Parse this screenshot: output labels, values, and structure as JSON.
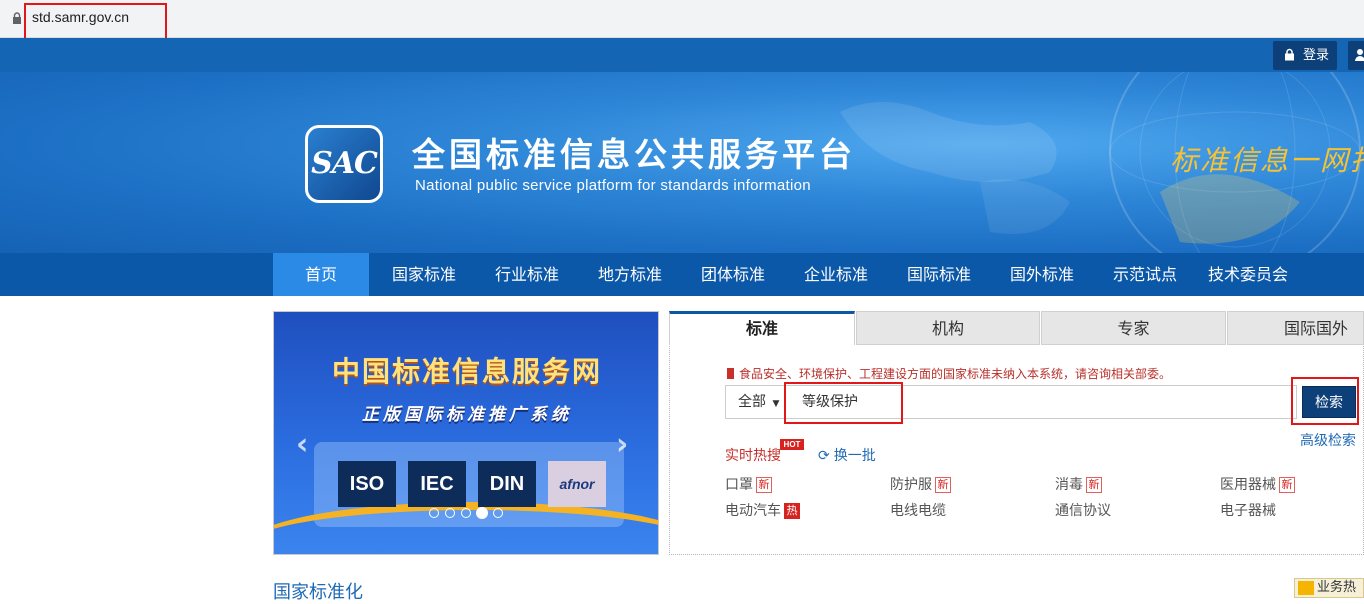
{
  "browser": {
    "url": "std.samr.gov.cn",
    "lock_icon": "lock-icon"
  },
  "header": {
    "login_label": "登录"
  },
  "banner": {
    "title_cn": "全国标准信息公共服务平台",
    "title_en": "National public service platform  for standards information",
    "logo_text": "SAC",
    "slogan": "标准信息一网打尽"
  },
  "nav": {
    "items": [
      {
        "label": "首页"
      },
      {
        "label": "国家标准"
      },
      {
        "label": "行业标准"
      },
      {
        "label": "地方标准"
      },
      {
        "label": "团体标准"
      },
      {
        "label": "企业标准"
      },
      {
        "label": "国际标准"
      },
      {
        "label": "国外标准"
      },
      {
        "label": "示范试点"
      },
      {
        "label": "技术委员会"
      }
    ],
    "active_index": 0
  },
  "carousel": {
    "title": "中国标准信息服务网",
    "subtitle": "正版国际标准推广系统",
    "logos": [
      "ISO",
      "IEC",
      "DIN",
      "afnor"
    ],
    "slide_count": 5,
    "active_slide": 4
  },
  "search": {
    "tabs": [
      "标准",
      "机构",
      "专家",
      "国际国外"
    ],
    "active_tab": 0,
    "notice": "食品安全、环境保护、工程建设方面的国家标准未纳入本系统，请咨询相关部委。",
    "scope": "全部",
    "query": "等级保护",
    "button": "检索",
    "advanced": "高级检索",
    "hot_label": "实时热搜",
    "hot_badge": "HOT",
    "refresh": "换一批",
    "keywords": [
      {
        "text": "口罩",
        "tag": "新"
      },
      {
        "text": "防护服",
        "tag": "新"
      },
      {
        "text": "消毒",
        "tag": "新"
      },
      {
        "text": "医用器械",
        "tag": "新"
      },
      {
        "text": "电动汽车",
        "tag": "热"
      },
      {
        "text": "电线电缆",
        "tag": ""
      },
      {
        "text": "通信协议",
        "tag": ""
      },
      {
        "text": "电子器械",
        "tag": ""
      }
    ]
  },
  "footer": {
    "section_title": "国家标准化",
    "corner_label": "业务热"
  },
  "colors": {
    "primary": "#0c58a8",
    "dark": "#0d3f79",
    "highlight": "#e1171a",
    "active_nav": "#2a8ae6"
  }
}
